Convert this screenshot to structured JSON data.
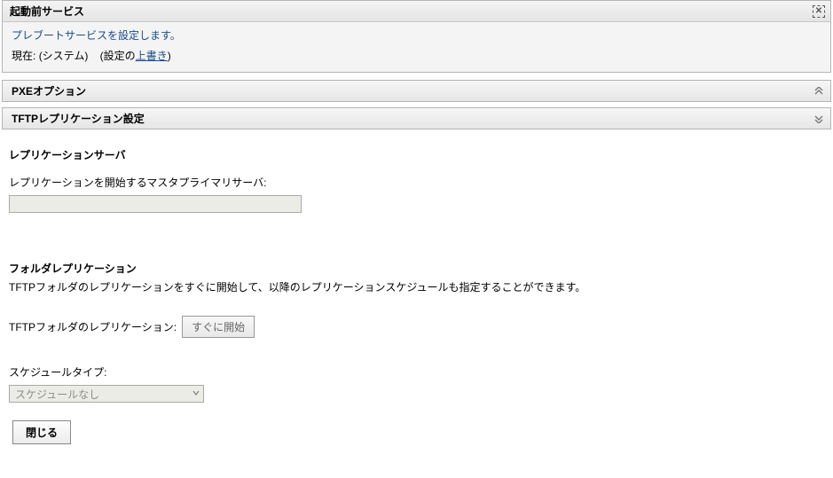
{
  "header": {
    "title": "起動前サービス",
    "description": "プレブートサービスを設定します。",
    "current_prefix": "現在:",
    "current_scope": "(システム)",
    "settings_of": "(設定の",
    "overwrite_link": "上書き",
    "settings_close": ")"
  },
  "sections": {
    "pxe": {
      "title": "PXEオプション"
    },
    "tftp": {
      "title": "TFTPレプリケーション設定"
    }
  },
  "replication": {
    "server_heading": "レプリケーションサーバ",
    "master_label": "レプリケーションを開始するマスタプライマリサーバ:",
    "master_value": "",
    "folder_heading": "フォルダレプリケーション",
    "folder_desc": "TFTPフォルダのレプリケーションをすぐに開始して、以降のレプリケーションスケジュールも指定することができます。",
    "folder_action_label": "TFTPフォルダのレプリケーション:",
    "start_now_btn": "すぐに開始",
    "schedule_type_label": "スケジュールタイプ:",
    "schedule_selected": "スケジュールなし"
  },
  "footer": {
    "close_btn": "閉じる"
  }
}
